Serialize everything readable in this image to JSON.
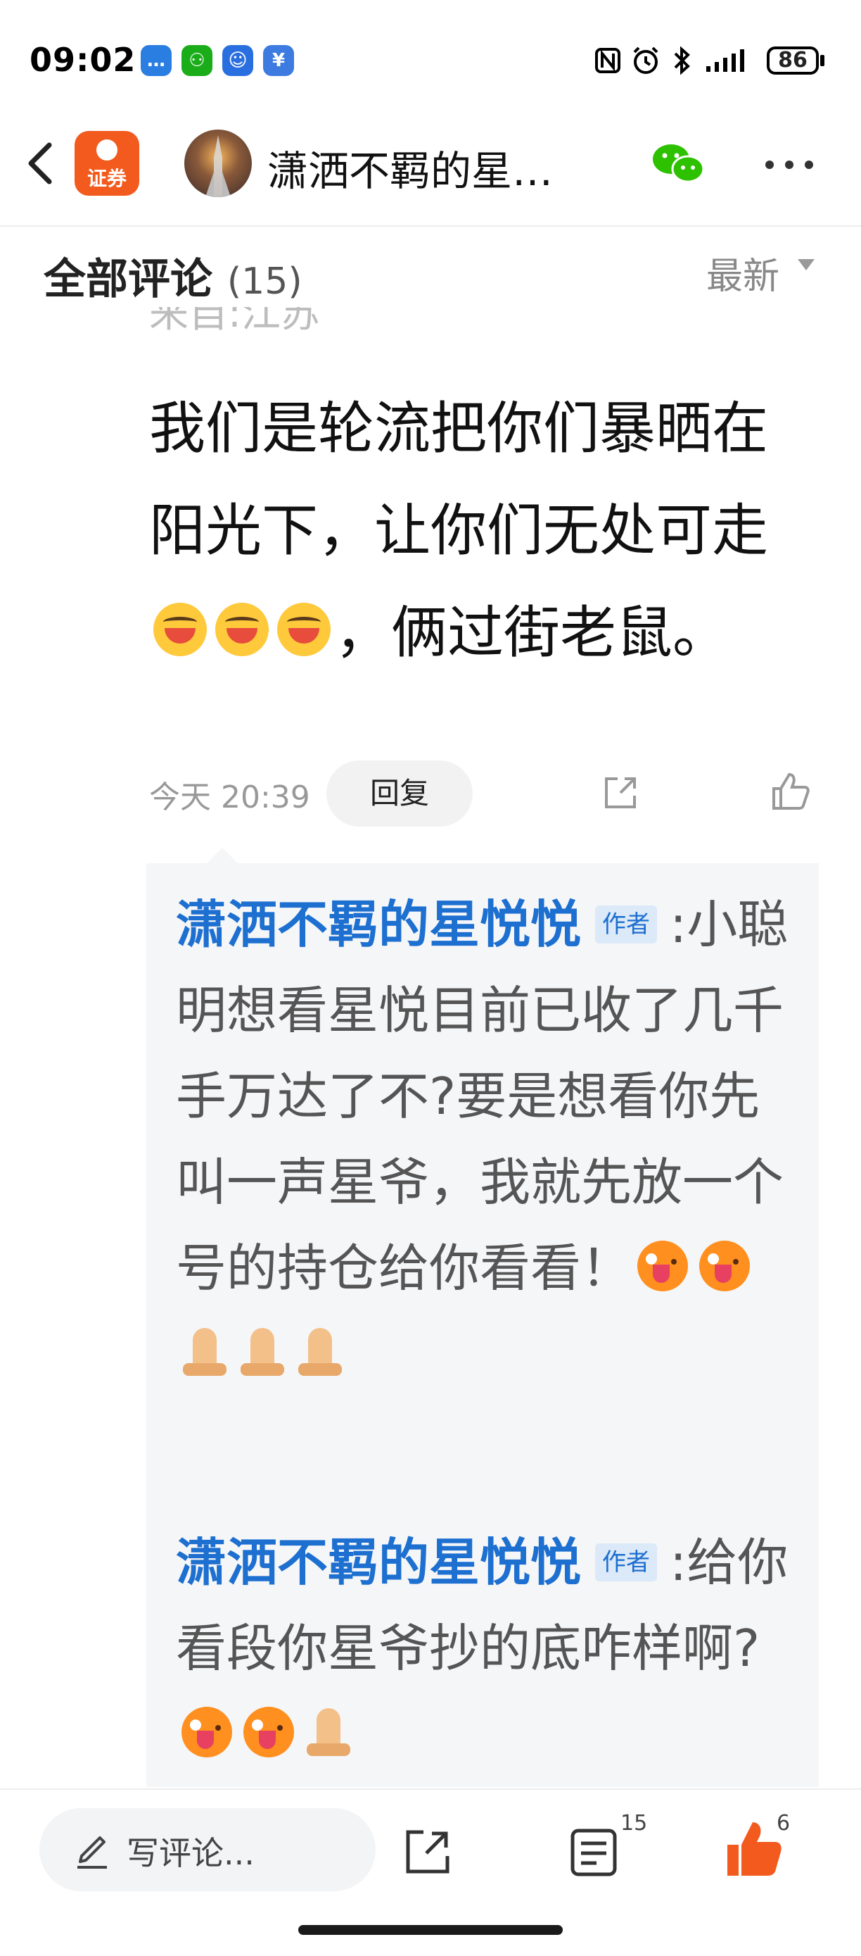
{
  "status_bar": {
    "time": "09:02",
    "apps": [
      {
        "name": "message-app-icon",
        "color": "#2a7de1",
        "glyph": "…"
      },
      {
        "name": "wechat-app-icon",
        "color": "#1aad19",
        "glyph": "⚇"
      },
      {
        "name": "contacts-app-icon",
        "color": "#2a6fe0",
        "glyph": "☺"
      },
      {
        "name": "finance-app-icon",
        "color": "#3d7be0",
        "glyph": "¥"
      }
    ],
    "battery": "86"
  },
  "nav": {
    "app_logo_text": "证券",
    "title": "潇洒不羁的星…"
  },
  "comments": {
    "header": "全部评论",
    "count": "(15)",
    "sort": "最新",
    "location_partial": "来自:江苏"
  },
  "comment": {
    "segments": [
      "我们是轮流把你们暴晒在阳光下，让你们无处可走",
      "，俩过街老鼠。"
    ],
    "emoji": [
      "laugh-emoji",
      "laugh-emoji",
      "laugh-emoji"
    ],
    "time": "今天 20:39",
    "reply_label": "回复"
  },
  "replies": [
    {
      "author": "潇洒不羁的星悦悦",
      "badge": "作者",
      "colon": ":",
      "text": "小聪明想看星悦目前已收了几千手万达了不?要是想看你先叫一声星爷，我就先放一个号的持仓给你看看！",
      "emoji": [
        "wink-emoji",
        "wink-emoji",
        "pray-emoji",
        "pray-emoji",
        "pray-emoji"
      ]
    },
    {
      "author": "潇洒不羁的星悦悦",
      "badge": "作者",
      "colon": ":",
      "text": "给你看段你星爷抄的底咋样啊?",
      "emoji": [
        "wink-emoji",
        "wink-emoji",
        "pray-emoji"
      ]
    }
  ],
  "bottom_bar": {
    "write_placeholder": "写评论...",
    "comments_count": "15",
    "likes_count": "6",
    "accent": "#f25a1e"
  }
}
